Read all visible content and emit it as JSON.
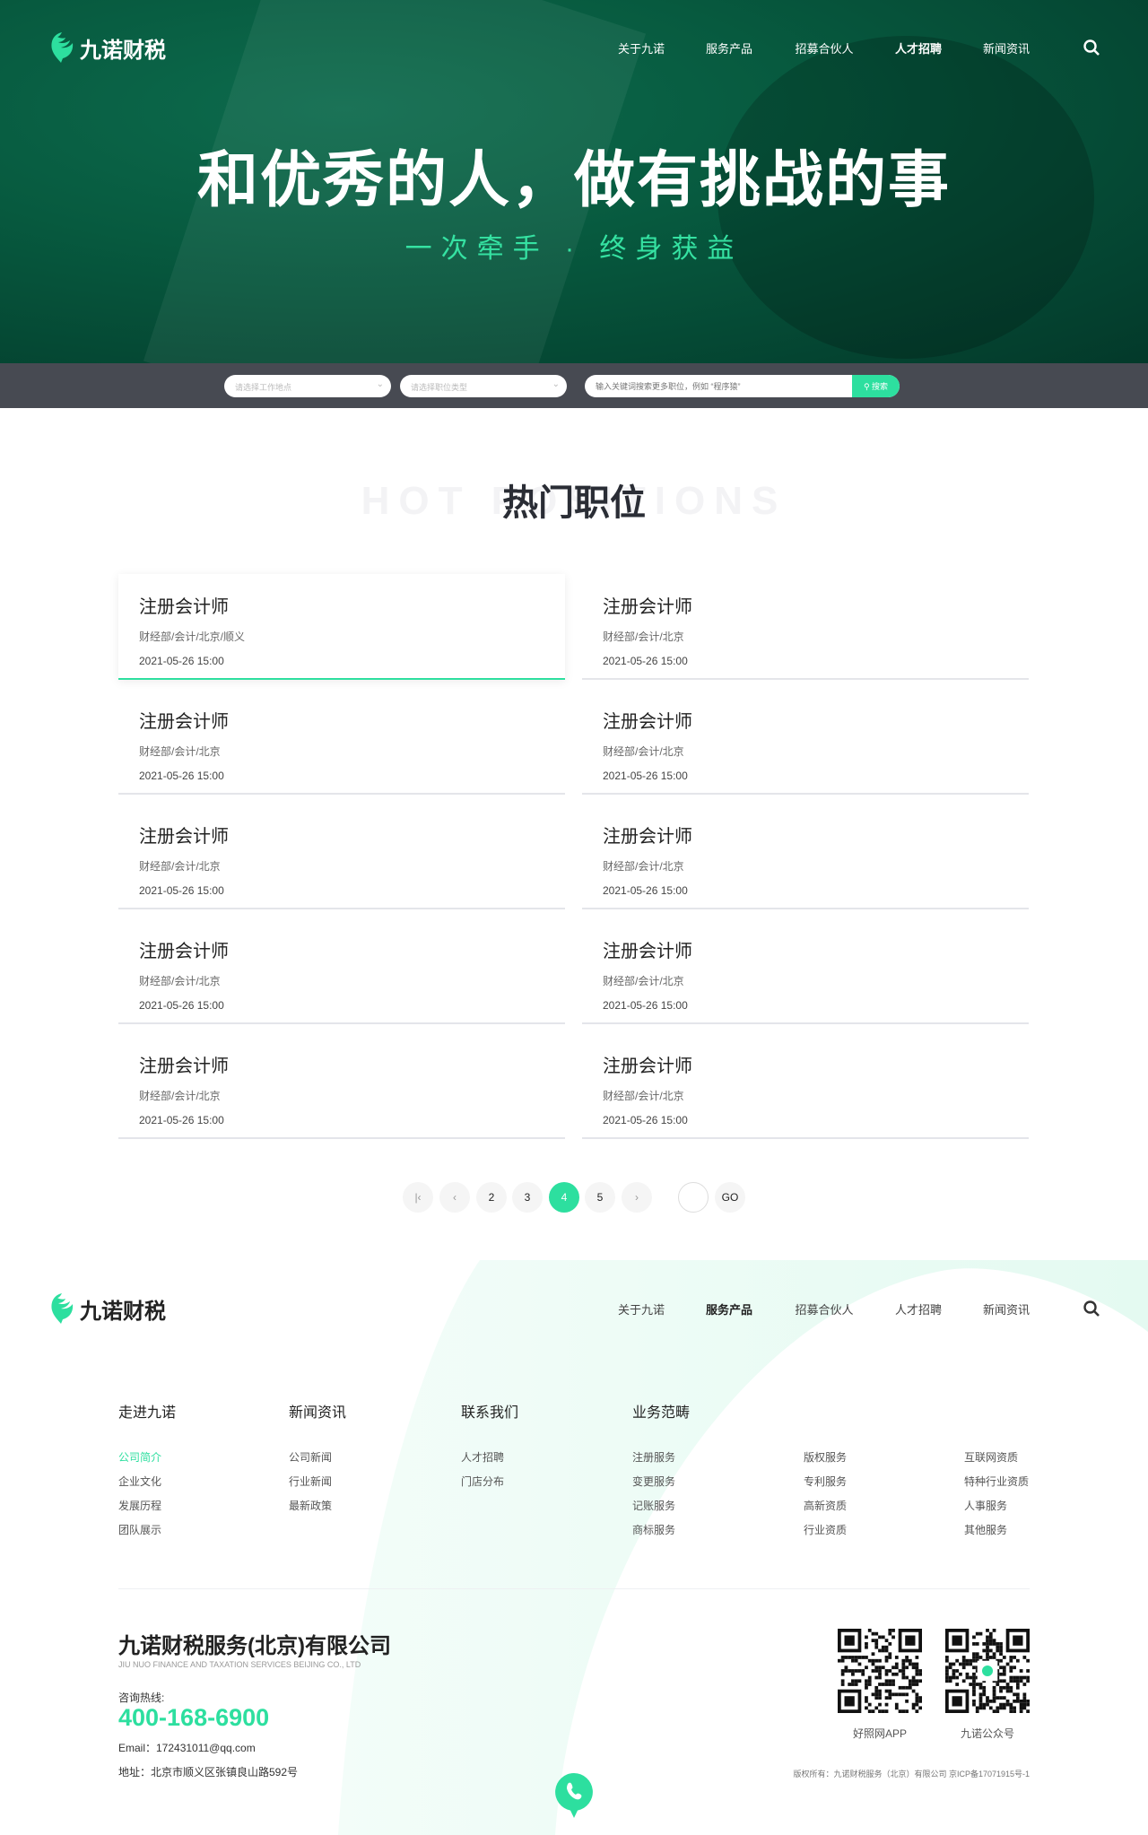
{
  "brand": {
    "name": "九诺财税",
    "accent": "#2ddf9f"
  },
  "nav": {
    "items": [
      "关于九诺",
      "服务产品",
      "招募合伙人",
      "人才招聘",
      "新闻资讯"
    ],
    "active_top": "人才招聘",
    "active_footer": "服务产品"
  },
  "hero": {
    "title": "和优秀的人，做有挑战的事",
    "subtitle": "一次牵手 · 终身获益"
  },
  "search": {
    "location_placeholder": "请选择工作地点",
    "type_placeholder": "请选择职位类型",
    "keyword_placeholder": "输入关键词搜索更多职位，例如 “程序猿”",
    "button": "搜索"
  },
  "section": {
    "title": "热门职位",
    "watermark": "HOT POSITIONS"
  },
  "jobs": [
    {
      "title": "注册会计师",
      "dept": "财经部/会计/北京/顺义",
      "date": "2021-05-26 15:00"
    },
    {
      "title": "注册会计师",
      "dept": "财经部/会计/北京",
      "date": "2021-05-26 15:00"
    },
    {
      "title": "注册会计师",
      "dept": "财经部/会计/北京",
      "date": "2021-05-26 15:00"
    },
    {
      "title": "注册会计师",
      "dept": "财经部/会计/北京",
      "date": "2021-05-26 15:00"
    },
    {
      "title": "注册会计师",
      "dept": "财经部/会计/北京",
      "date": "2021-05-26 15:00"
    },
    {
      "title": "注册会计师",
      "dept": "财经部/会计/北京",
      "date": "2021-05-26 15:00"
    },
    {
      "title": "注册会计师",
      "dept": "财经部/会计/北京",
      "date": "2021-05-26 15:00"
    },
    {
      "title": "注册会计师",
      "dept": "财经部/会计/北京",
      "date": "2021-05-26 15:00"
    },
    {
      "title": "注册会计师",
      "dept": "财经部/会计/北京",
      "date": "2021-05-26 15:00"
    },
    {
      "title": "注册会计师",
      "dept": "财经部/会计/北京",
      "date": "2021-05-26 15:00"
    }
  ],
  "pagination": {
    "first": "|‹",
    "prev": "‹",
    "pages": [
      "2",
      "3",
      "4",
      "5"
    ],
    "current": "4",
    "next": "›",
    "go": "GO"
  },
  "footer": {
    "columns": [
      {
        "heading": "走进九诺",
        "links": [
          "公司简介",
          "企业文化",
          "发展历程",
          "团队展示"
        ]
      },
      {
        "heading": "新闻资讯",
        "links": [
          "公司新闻",
          "行业新闻",
          "最新政策"
        ]
      },
      {
        "heading": "联系我们",
        "links": [
          "人才招聘",
          "门店分布"
        ]
      },
      {
        "heading": "业务范畴",
        "links": [
          "注册服务",
          "变更服务",
          "记账服务",
          "商标服务"
        ]
      },
      {
        "heading": "",
        "links": [
          "版权服务",
          "专利服务",
          "高新资质",
          "行业资质"
        ]
      },
      {
        "heading": "",
        "links": [
          "互联网资质",
          "特种行业资质",
          "人事服务",
          "其他服务"
        ]
      }
    ],
    "company": "九诺财税服务(北京)有限公司",
    "company_en": "JIU NUO FINANCE AND TAXATION SERVICES BEIJING CO., LTD",
    "hotline_label": "咨询热线:",
    "hotline": "400-168-6900",
    "email": "Email：172431011@qq.com",
    "address": "地址：北京市顺义区张镇良山路592号",
    "qr": [
      {
        "label": "好照网APP"
      },
      {
        "label": "九诺公众号"
      }
    ],
    "copyright": "版权所有：九诺财税服务（北京）有限公司 京ICP备17071915号-1"
  }
}
